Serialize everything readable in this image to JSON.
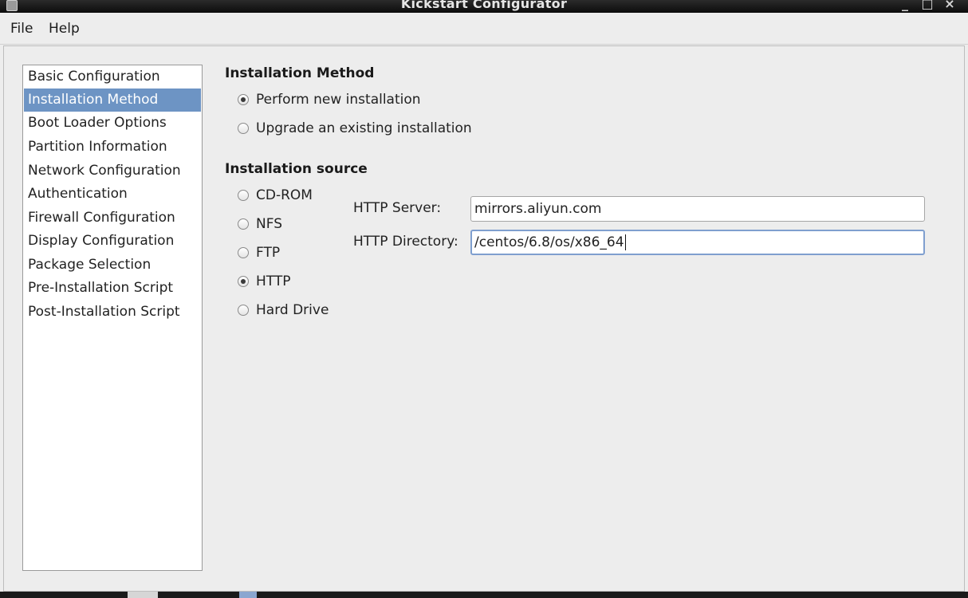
{
  "window": {
    "title": "Kickstart Configurator",
    "controls": {
      "minimize": "_",
      "maximize": "□",
      "close": "×"
    }
  },
  "menubar": {
    "items": [
      "File",
      "Help"
    ]
  },
  "sidebar": {
    "items": [
      "Basic Configuration",
      "Installation Method",
      "Boot Loader Options",
      "Partition Information",
      "Network Configuration",
      "Authentication",
      "Firewall Configuration",
      "Display Configuration",
      "Package Selection",
      "Pre-Installation Script",
      "Post-Installation Script"
    ],
    "selected": "Installation Method"
  },
  "installation_method": {
    "heading": "Installation Method",
    "options": [
      {
        "label": "Perform new installation",
        "checked": true
      },
      {
        "label": "Upgrade an existing installation",
        "checked": false
      }
    ]
  },
  "installation_source": {
    "heading": "Installation source",
    "options": [
      {
        "label": "CD-ROM",
        "checked": false
      },
      {
        "label": "NFS",
        "checked": false
      },
      {
        "label": "FTP",
        "checked": false
      },
      {
        "label": "HTTP",
        "checked": true
      },
      {
        "label": "Hard Drive",
        "checked": false
      }
    ],
    "http_server": {
      "label": "HTTP Server:",
      "value": "mirrors.aliyun.com"
    },
    "http_directory": {
      "label": "HTTP Directory:",
      "value": "/centos/6.8/os/x86_64"
    }
  }
}
